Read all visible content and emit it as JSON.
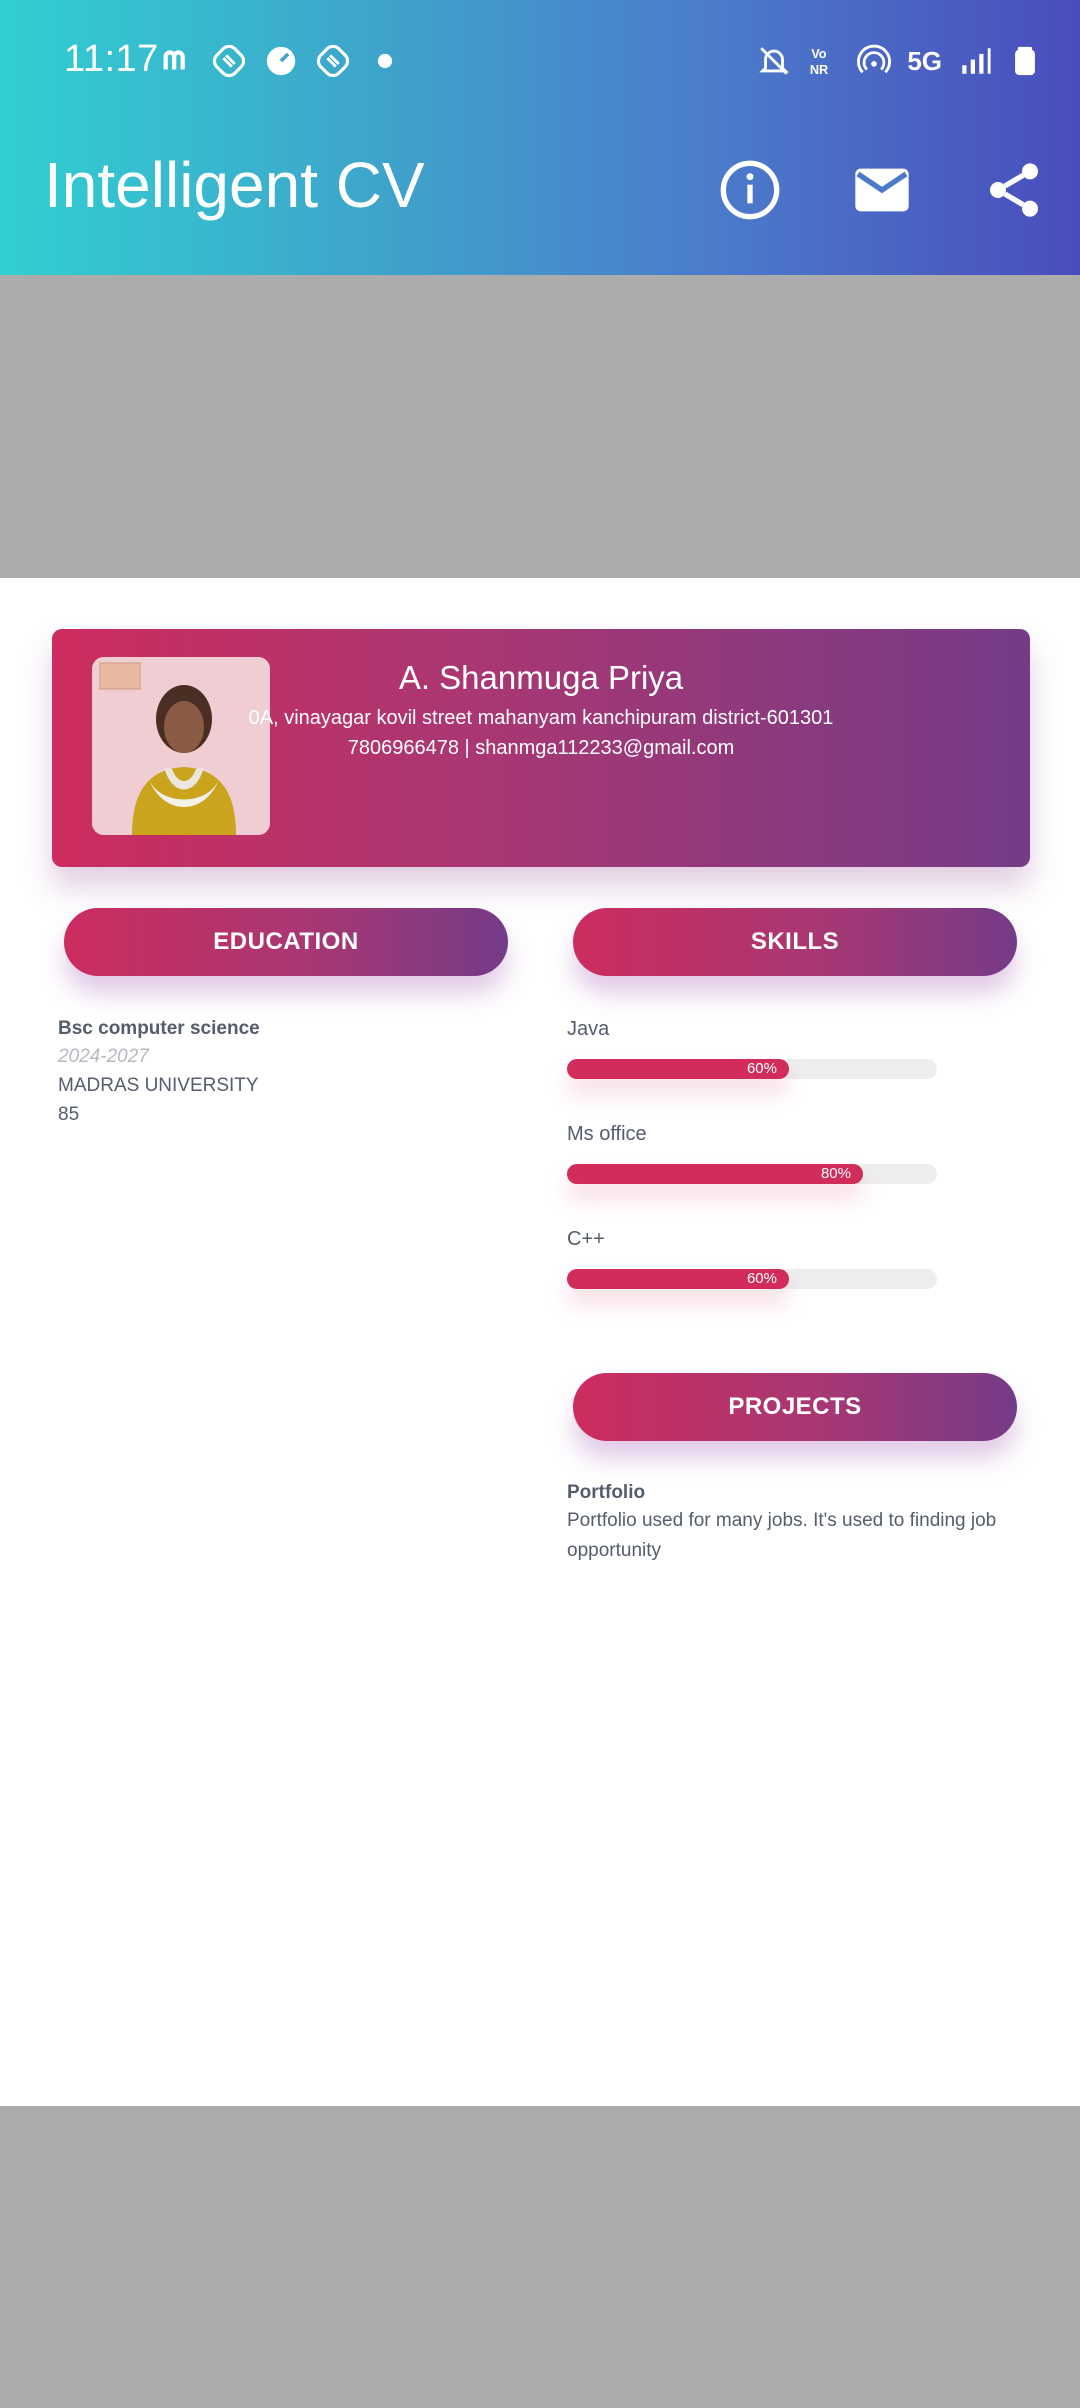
{
  "status_bar": {
    "time": "11:17",
    "network": "5G",
    "left_icons": [
      "m-icon",
      "shield-icon",
      "gauge-icon",
      "shield-icon",
      "dot-icon"
    ],
    "right_icons": [
      "bell-off-icon",
      "vonr-icon",
      "hotspot-icon",
      "5g-icon",
      "signal-icon",
      "battery-icon"
    ]
  },
  "app_bar": {
    "title": "Intelligent CV",
    "actions": [
      "info-icon",
      "mail-icon",
      "share-icon"
    ],
    "gradient": [
      "#31cfd1",
      "#4a4dbd"
    ]
  },
  "profile": {
    "name": "A. Shanmuga Priya",
    "address": "0A, vinayagar kovil street mahanyam kanchipuram district-601301",
    "contact": "7806966478 | shanmga112233@gmail.com"
  },
  "sections": {
    "education": "EDUCATION",
    "skills": "SKILLS",
    "projects": "PROJECTS"
  },
  "education": {
    "degree": "Bsc computer science",
    "years": "2024-2027",
    "university": "MADRAS UNIVERSITY",
    "score": "85"
  },
  "skills": [
    {
      "name": "Java",
      "level": "60%"
    },
    {
      "name": "Ms office",
      "level": "80%"
    },
    {
      "name": "C++",
      "level": "60%"
    }
  ],
  "project": {
    "title": "Portfolio",
    "description": "Portfolio used for many jobs. It's used to finding job opportunity"
  },
  "colors": {
    "accent": "#d22c5b",
    "accent_end": "#753b87",
    "text": "#555d6b",
    "placeholder_gray": "#acacac"
  }
}
